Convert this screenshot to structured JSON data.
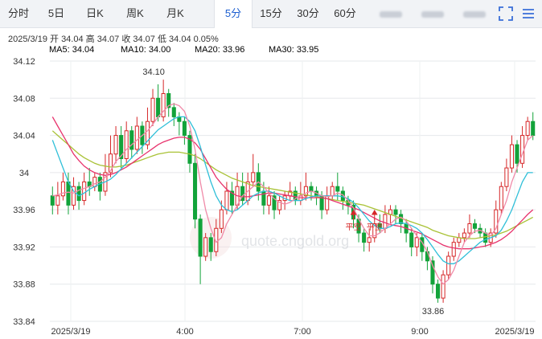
{
  "tabs": [
    "分时",
    "5日",
    "日K",
    "周K",
    "月K",
    "5分",
    "15分",
    "30分",
    "60分"
  ],
  "info": {
    "date": "2025/3/19",
    "open_label": "开",
    "open": "34.04",
    "high_label": "高",
    "high": "34.07",
    "close_label": "收",
    "close": "34.07",
    "low_label": "低",
    "low": "34.04",
    "change": "0.05%"
  },
  "watermark": "quote.cngold.org",
  "colors": {
    "up": "#d62728",
    "down": "#12a33a",
    "ma5": "#f08aa8",
    "ma10": "#2fbfd8",
    "ma20": "#e8336d",
    "ma30": "#a9c236",
    "tab_active": "#1d5fd0"
  },
  "chart_data": {
    "type": "candlestick",
    "ylim": [
      33.84,
      34.12
    ],
    "yticks": [
      "34.12",
      "34.08",
      "34.04",
      "34",
      "33.96",
      "33.92",
      "33.88",
      "33.84"
    ],
    "xticks": [
      "2025/3/19",
      "4:00",
      "7:00",
      "9:00",
      "2025/3/19"
    ],
    "legend": [
      {
        "label": "MA5: 34.04",
        "color": "#f08aa8"
      },
      {
        "label": "MA10: 34.00",
        "color": "#2fbfd8"
      },
      {
        "label": "MA20: 33.96",
        "color": "#e8336d"
      },
      {
        "label": "MA30: 33.95",
        "color": "#a9c236"
      }
    ],
    "annotations": [
      "34.10",
      "33.86"
    ],
    "markers": [
      "平空",
      "平空"
    ],
    "candles": [
      [
        33.975,
        33.965,
        33.985,
        33.955
      ],
      [
        33.965,
        33.975,
        33.99,
        33.955
      ],
      [
        33.975,
        33.99,
        34.0,
        33.97
      ],
      [
        33.99,
        33.965,
        34.0,
        33.955
      ],
      [
        33.965,
        33.985,
        33.995,
        33.96
      ],
      [
        33.985,
        33.97,
        33.99,
        33.96
      ],
      [
        33.97,
        33.99,
        34.0,
        33.965
      ],
      [
        33.99,
        33.985,
        34.005,
        33.975
      ],
      [
        33.985,
        33.995,
        34.0,
        33.98
      ],
      [
        33.995,
        33.98,
        34.0,
        33.97
      ],
      [
        33.98,
        34.0,
        34.02,
        33.975
      ],
      [
        34.0,
        34.02,
        34.04,
        33.995
      ],
      [
        34.02,
        34.04,
        34.05,
        34.01
      ],
      [
        34.04,
        34.015,
        34.05,
        34.005
      ],
      [
        34.015,
        34.045,
        34.055,
        34.01
      ],
      [
        34.045,
        34.025,
        34.05,
        34.015
      ],
      [
        34.025,
        34.05,
        34.06,
        34.02
      ],
      [
        34.05,
        34.03,
        34.055,
        34.02
      ],
      [
        34.03,
        34.055,
        34.07,
        34.025
      ],
      [
        34.055,
        34.08,
        34.09,
        34.05
      ],
      [
        34.08,
        34.06,
        34.095,
        34.055
      ],
      [
        34.06,
        34.085,
        34.1,
        34.055
      ],
      [
        34.085,
        34.07,
        34.09,
        34.06
      ],
      [
        34.07,
        34.06,
        34.075,
        34.05
      ],
      [
        34.06,
        34.055,
        34.065,
        34.04
      ],
      [
        34.055,
        34.04,
        34.06,
        34.03
      ],
      [
        34.04,
        34.01,
        34.045,
        34.0
      ],
      [
        34.01,
        33.95,
        34.02,
        33.94
      ],
      [
        33.95,
        33.91,
        33.955,
        33.88
      ],
      [
        33.91,
        33.93,
        33.935,
        33.905
      ],
      [
        33.93,
        33.915,
        33.935,
        33.905
      ],
      [
        33.915,
        33.94,
        33.95,
        33.91
      ],
      [
        33.94,
        33.96,
        33.97,
        33.935
      ],
      [
        33.96,
        33.98,
        33.99,
        33.955
      ],
      [
        33.98,
        33.965,
        33.99,
        33.955
      ],
      [
        33.965,
        33.985,
        34.0,
        33.96
      ],
      [
        33.985,
        33.97,
        34.0,
        33.965
      ],
      [
        33.97,
        33.99,
        34.0,
        33.965
      ],
      [
        33.99,
        34.0,
        34.02,
        33.985
      ],
      [
        34.0,
        33.98,
        34.01,
        33.97
      ],
      [
        33.98,
        33.965,
        33.99,
        33.955
      ],
      [
        33.965,
        33.975,
        33.985,
        33.955
      ],
      [
        33.975,
        33.96,
        33.98,
        33.95
      ],
      [
        33.96,
        33.97,
        33.975,
        33.955
      ],
      [
        33.97,
        33.975,
        33.98,
        33.96
      ],
      [
        33.975,
        33.98,
        33.99,
        33.97
      ],
      [
        33.98,
        33.97,
        33.985,
        33.965
      ],
      [
        33.97,
        33.975,
        33.99,
        33.965
      ],
      [
        33.975,
        33.985,
        34.0,
        33.97
      ],
      [
        33.985,
        33.98,
        33.99,
        33.97
      ],
      [
        33.98,
        33.975,
        33.985,
        33.965
      ],
      [
        33.975,
        33.96,
        33.98,
        33.95
      ],
      [
        33.96,
        33.975,
        33.985,
        33.955
      ],
      [
        33.975,
        33.985,
        33.99,
        33.97
      ],
      [
        33.985,
        33.98,
        34.0,
        33.97
      ],
      [
        33.98,
        33.97,
        33.985,
        33.96
      ],
      [
        33.97,
        33.965,
        33.975,
        33.955
      ],
      [
        33.965,
        33.95,
        33.97,
        33.94
      ],
      [
        33.95,
        33.935,
        33.955,
        33.925
      ],
      [
        33.935,
        33.925,
        33.94,
        33.915
      ],
      [
        33.925,
        33.93,
        33.94,
        33.915
      ],
      [
        33.93,
        33.945,
        33.95,
        33.925
      ],
      [
        33.945,
        33.94,
        33.955,
        33.935
      ],
      [
        33.94,
        33.955,
        33.965,
        33.935
      ],
      [
        33.955,
        33.96,
        33.965,
        33.945
      ],
      [
        33.96,
        33.955,
        33.965,
        33.945
      ],
      [
        33.955,
        33.945,
        33.96,
        33.935
      ],
      [
        33.945,
        33.935,
        33.95,
        33.925
      ],
      [
        33.935,
        33.92,
        33.94,
        33.91
      ],
      [
        33.92,
        33.93,
        33.935,
        33.91
      ],
      [
        33.93,
        33.915,
        33.935,
        33.905
      ],
      [
        33.915,
        33.905,
        33.92,
        33.895
      ],
      [
        33.905,
        33.88,
        33.91,
        33.87
      ],
      [
        33.88,
        33.865,
        33.885,
        33.86
      ],
      [
        33.865,
        33.89,
        33.895,
        33.86
      ],
      [
        33.89,
        33.91,
        33.915,
        33.885
      ],
      [
        33.91,
        33.925,
        33.93,
        33.905
      ],
      [
        33.925,
        33.93,
        33.935,
        33.92
      ],
      [
        33.93,
        33.935,
        33.94,
        33.925
      ],
      [
        33.935,
        33.945,
        33.955,
        33.93
      ],
      [
        33.945,
        33.94,
        33.95,
        33.935
      ],
      [
        33.94,
        33.935,
        33.945,
        33.93
      ],
      [
        33.935,
        33.925,
        33.94,
        33.92
      ],
      [
        33.925,
        33.935,
        33.94,
        33.92
      ],
      [
        33.935,
        33.96,
        33.97,
        33.93
      ],
      [
        33.96,
        33.985,
        33.99,
        33.955
      ],
      [
        33.985,
        34.005,
        34.015,
        33.98
      ],
      [
        34.005,
        34.03,
        34.04,
        34.0
      ],
      [
        34.03,
        34.01,
        34.035,
        34.0
      ],
      [
        34.01,
        34.04,
        34.05,
        34.005
      ],
      [
        34.04,
        34.055,
        34.06,
        34.035
      ],
      [
        34.055,
        34.04,
        34.065,
        34.035
      ]
    ],
    "ma": {
      "ma5": [
        33.975,
        33.976,
        33.978,
        33.979,
        33.978,
        33.981,
        33.983,
        33.985,
        33.988,
        33.99,
        33.995,
        34.002,
        34.012,
        34.018,
        34.025,
        34.03,
        34.035,
        34.04,
        34.045,
        34.052,
        34.06,
        34.066,
        34.072,
        34.074,
        34.072,
        34.066,
        34.05,
        34.025,
        33.99,
        33.96,
        33.94,
        33.925,
        33.93,
        33.945,
        33.955,
        33.965,
        33.975,
        33.98,
        33.985,
        33.99,
        33.985,
        33.978,
        33.972,
        33.968,
        33.966,
        33.968,
        33.972,
        33.975,
        33.978,
        33.98,
        33.978,
        33.975,
        33.974,
        33.975,
        33.978,
        33.976,
        33.97,
        33.962,
        33.95,
        33.94,
        33.932,
        33.932,
        33.935,
        33.94,
        33.945,
        33.95,
        33.952,
        33.948,
        33.94,
        33.932,
        33.925,
        33.915,
        33.9,
        33.888,
        33.88,
        33.885,
        33.895,
        33.91,
        33.925,
        33.932,
        33.937,
        33.938,
        33.935,
        33.932,
        33.94,
        33.955,
        33.97,
        33.99,
        34.005,
        34.02,
        34.035,
        34.04
      ],
      "ma10": [
        34.035,
        34.02,
        34.005,
        33.99,
        33.98,
        33.975,
        33.978,
        33.982,
        33.985,
        33.988,
        33.99,
        33.993,
        33.998,
        34.004,
        34.01,
        34.016,
        34.022,
        34.028,
        34.034,
        34.04,
        34.046,
        34.05,
        34.054,
        34.058,
        34.06,
        34.06,
        34.055,
        34.045,
        34.028,
        34.008,
        33.99,
        33.975,
        33.965,
        33.96,
        33.958,
        33.96,
        33.965,
        33.97,
        33.975,
        33.978,
        33.98,
        33.98,
        33.978,
        33.975,
        33.972,
        33.97,
        33.97,
        33.97,
        33.972,
        33.974,
        33.975,
        33.975,
        33.975,
        33.975,
        33.975,
        33.974,
        33.972,
        33.968,
        33.962,
        33.955,
        33.948,
        33.943,
        33.94,
        33.94,
        33.942,
        33.945,
        33.946,
        33.945,
        33.943,
        33.94,
        33.935,
        33.928,
        33.92,
        33.912,
        33.905,
        33.902,
        33.902,
        33.905,
        33.91,
        33.915,
        33.92,
        33.925,
        33.928,
        33.93,
        33.932,
        33.938,
        33.948,
        33.96,
        33.975,
        33.99,
        34.0,
        34.0
      ],
      "ma20": [
        34.06,
        34.05,
        34.04,
        34.03,
        34.02,
        34.013,
        34.007,
        34.003,
        34.0,
        33.998,
        33.997,
        33.998,
        34.0,
        34.003,
        34.006,
        34.01,
        34.014,
        34.018,
        34.022,
        34.026,
        34.03,
        34.033,
        34.035,
        34.037,
        34.038,
        34.038,
        34.036,
        34.032,
        34.025,
        34.015,
        34.005,
        33.995,
        33.988,
        33.982,
        33.978,
        33.975,
        33.974,
        33.974,
        33.975,
        33.976,
        33.977,
        33.978,
        33.978,
        33.977,
        33.976,
        33.975,
        33.974,
        33.973,
        33.973,
        33.973,
        33.973,
        33.973,
        33.972,
        33.97,
        33.968,
        33.966,
        33.964,
        33.962,
        33.96,
        33.957,
        33.954,
        33.951,
        33.948,
        33.946,
        33.944,
        33.943,
        33.942,
        33.94,
        33.938,
        33.936,
        33.934,
        33.931,
        33.928,
        33.925,
        33.922,
        33.92,
        33.919,
        33.918,
        33.918,
        33.918,
        33.919,
        33.92,
        33.921,
        33.923,
        33.925,
        33.928,
        33.932,
        33.937,
        33.943,
        33.949,
        33.955,
        33.96
      ],
      "ma30": [
        34.045,
        34.04,
        34.035,
        34.03,
        34.025,
        34.02,
        34.016,
        34.013,
        34.01,
        34.008,
        34.007,
        34.006,
        34.006,
        34.007,
        34.008,
        34.01,
        34.012,
        34.014,
        34.016,
        34.018,
        34.02,
        34.021,
        34.022,
        34.022,
        34.022,
        34.021,
        34.02,
        34.018,
        34.015,
        34.011,
        34.007,
        34.003,
        34.0,
        33.997,
        33.994,
        33.992,
        33.99,
        33.988,
        33.986,
        33.985,
        33.984,
        33.983,
        33.982,
        33.981,
        33.98,
        33.979,
        33.978,
        33.977,
        33.976,
        33.975,
        33.974,
        33.973,
        33.972,
        33.971,
        33.97,
        33.969,
        33.968,
        33.967,
        33.966,
        33.965,
        33.963,
        33.961,
        33.959,
        33.957,
        33.955,
        33.953,
        33.951,
        33.949,
        33.947,
        33.945,
        33.943,
        33.941,
        33.938,
        33.936,
        33.934,
        33.932,
        33.931,
        33.93,
        33.929,
        33.929,
        33.929,
        33.93,
        33.931,
        33.932,
        33.933,
        33.935,
        33.937,
        33.94,
        33.943,
        33.946,
        33.949,
        33.952
      ]
    }
  }
}
